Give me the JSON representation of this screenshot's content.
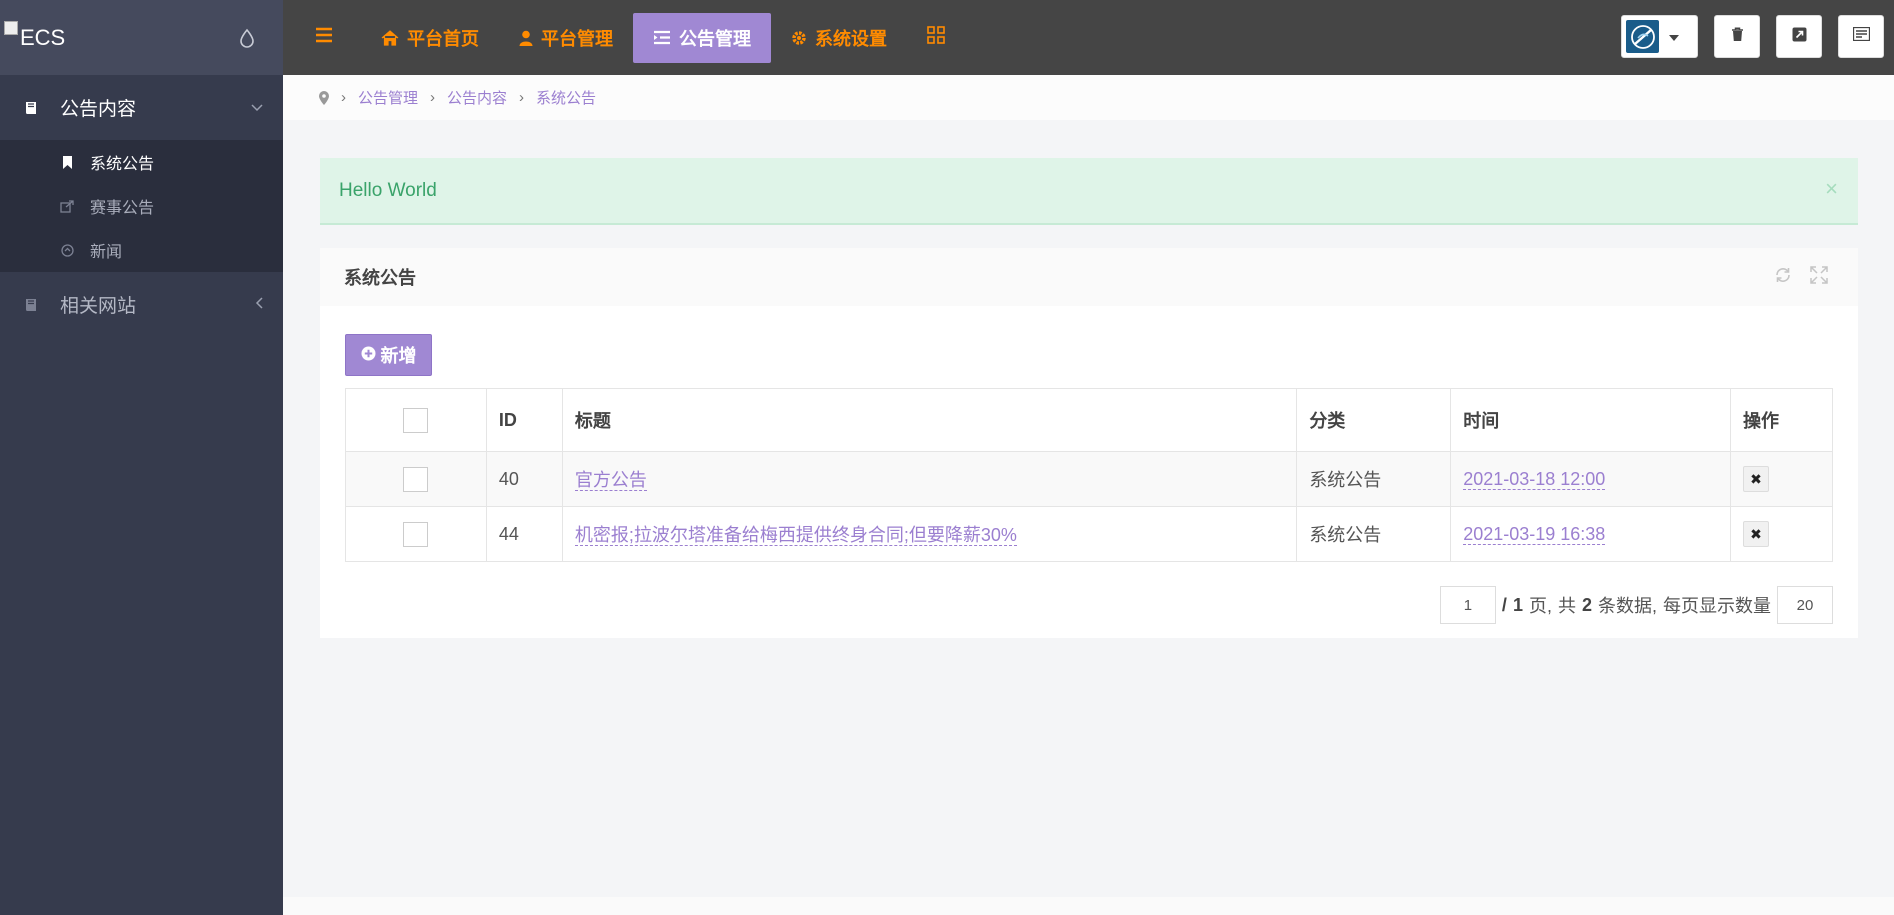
{
  "logo": {
    "alt": "ECS"
  },
  "sidebar": {
    "groups": [
      {
        "label": "公告内容",
        "expanded": true,
        "items": [
          {
            "label": "系统公告",
            "active": true,
            "icon": "bookmark-icon"
          },
          {
            "label": "赛事公告",
            "active": false,
            "icon": "share-icon"
          },
          {
            "label": "新闻",
            "active": false,
            "icon": "circle-up-icon"
          }
        ]
      },
      {
        "label": "相关网站",
        "expanded": false
      }
    ]
  },
  "topnav": {
    "items": [
      {
        "label": "平台首页",
        "icon": "home-icon"
      },
      {
        "label": "平台管理",
        "icon": "user-icon"
      },
      {
        "label": "公告管理",
        "icon": "list-icon",
        "active": true
      },
      {
        "label": "系统设置",
        "icon": "gear-icon"
      }
    ]
  },
  "breadcrumb": [
    "公告管理",
    "公告内容",
    "系统公告"
  ],
  "alert": {
    "text": "Hello World",
    "close": "×"
  },
  "panel": {
    "title": "系统公告",
    "add_label": "新增",
    "columns": [
      "ID",
      "标题",
      "分类",
      "时间",
      "操作"
    ],
    "rows": [
      {
        "id": "40",
        "title": "官方公告",
        "category": "系统公告",
        "time": "2021-03-18 12:00"
      },
      {
        "id": "44",
        "title": "机密报;拉波尔塔准备给梅西提供终身合同;但要降薪30%",
        "category": "系统公告",
        "time": "2021-03-19 16:38"
      }
    ]
  },
  "pager": {
    "current_page": "1",
    "slash": "/",
    "total_pages": "1",
    "page_unit": "页,",
    "total_prefix": "共",
    "total_count": "2",
    "total_suffix": "条数据,",
    "page_size_label": "每页显示数量",
    "page_size": "20"
  },
  "colors": {
    "accent": "#a088d3",
    "nav_text": "#ff8b00",
    "topbar": "#454545",
    "sidebar": "#363b4d"
  }
}
